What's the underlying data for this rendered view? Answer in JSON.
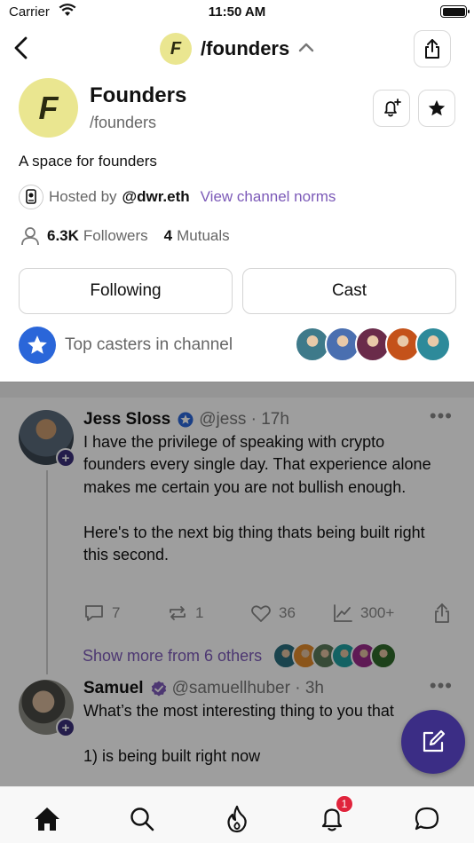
{
  "status_bar": {
    "carrier": "Carrier",
    "time": "11:50 AM"
  },
  "nav": {
    "logo_letter": "F",
    "title": "/founders"
  },
  "channel": {
    "logo_letter": "F",
    "name": "Founders",
    "handle": "/founders",
    "description": "A space for founders",
    "hosted_label": "Hosted by",
    "host": "@dwr.eth",
    "norms_link": "View channel norms",
    "followers_count": "6.3K",
    "followers_label": "Followers",
    "mutuals_count": "4",
    "mutuals_label": "Mutuals"
  },
  "buttons": {
    "following": "Following",
    "cast": "Cast"
  },
  "top_casters": {
    "label": "Top casters in channel",
    "avatar_colors": [
      "#3e7a8a",
      "#4a6fb0",
      "#6a2b4a",
      "#c4521a",
      "#2d8a9a"
    ]
  },
  "posts": [
    {
      "name": "Jess Sloss",
      "handle": "@jess · 17h",
      "text": "I have the privilege of speaking with crypto founders every single day. That experience alone makes me certain you are not bullish enough.\n\nHere's to the next big thing thats being built right this second.",
      "replies": "7",
      "recasts": "1",
      "likes": "36",
      "views": "300+",
      "show_more": "Show more from 6 others",
      "more_avatar_colors": [
        "#2a6f7f",
        "#e08a2a",
        "#5a7a5a",
        "#1f9fa0",
        "#9a2a8a",
        "#2f6a2a"
      ]
    },
    {
      "name": "Samuel",
      "handle": "@samuellhuber · 3h",
      "text": "What’s the most interesting thing to you that\n\n1) is being built right now"
    }
  ],
  "colors": {
    "accent": "#7c5ab8",
    "fab": "#3b2d85",
    "badge": "#e0243c",
    "logo_bg": "#eae690"
  },
  "tabbar": {
    "notification_count": "1"
  }
}
